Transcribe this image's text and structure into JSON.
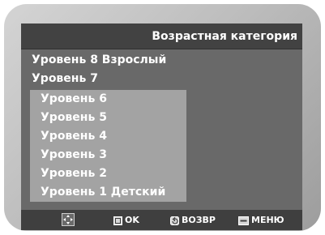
{
  "header": {
    "title": "Возрастная категория"
  },
  "menu": {
    "items": [
      {
        "label": "Уровень 8 Взрослый",
        "highlighted": false
      },
      {
        "label": "Уровень 7",
        "highlighted": false
      },
      {
        "label": "Уровень 6",
        "highlighted": true
      },
      {
        "label": "Уровень 5",
        "highlighted": true
      },
      {
        "label": "Уровень 4",
        "highlighted": true
      },
      {
        "label": "Уровень 3",
        "highlighted": true
      },
      {
        "label": "Уровень 2",
        "highlighted": true
      },
      {
        "label": "Уровень 1 Детский",
        "highlighted": true
      }
    ]
  },
  "footer": {
    "nav_icon": "directional-pad-icon",
    "ok_icon": "enter-icon",
    "ok_label": "OK",
    "back_icon": "return-icon",
    "back_label": "ВОЗВР",
    "menu_icon": "menu-icon",
    "menu_label": "МЕНЮ"
  },
  "colors": {
    "screen_bg": "#696969",
    "title_bg": "#424242",
    "highlight_bg": "#a3a3a3",
    "footer_bg": "#3f3f3f",
    "text": "#ffffff"
  }
}
